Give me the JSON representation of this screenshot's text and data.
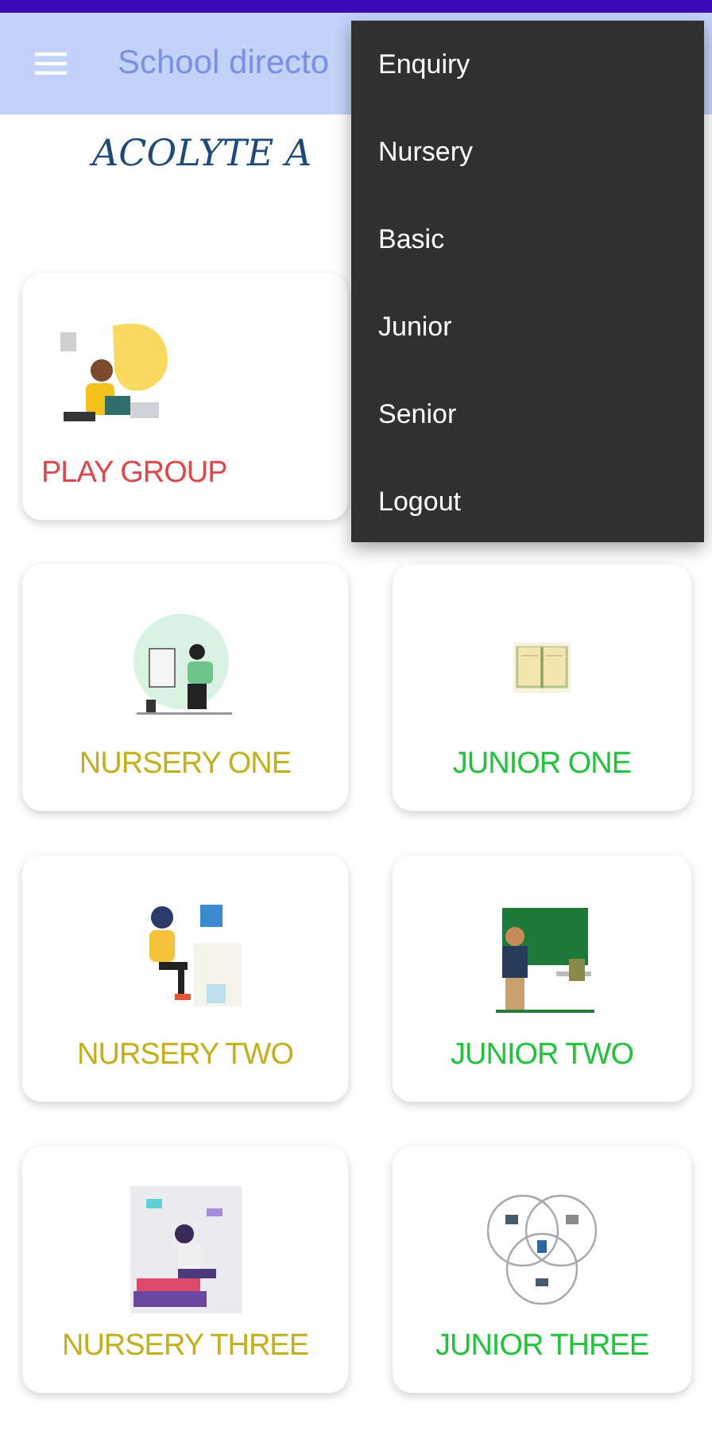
{
  "app_bar": {
    "title": "School directo"
  },
  "heading": "ACOLYTE A",
  "cards": [
    {
      "label": "PLAY GROUP",
      "color": "#e0474a"
    },
    {
      "label": "NURSERY ONE",
      "color": "#c4b01c"
    },
    {
      "label": "JUNIOR ONE",
      "color": "#1fc43a"
    },
    {
      "label": "NURSERY TWO",
      "color": "#c4b01c"
    },
    {
      "label": "JUNIOR TWO",
      "color": "#1fc43a"
    },
    {
      "label": "NURSERY THREE",
      "color": "#c4b01c"
    },
    {
      "label": "JUNIOR THREE",
      "color": "#1fc43a"
    }
  ],
  "menu": {
    "items": [
      "Enquiry",
      "Nursery",
      "Basic",
      "Junior",
      "Senior",
      "Logout"
    ]
  }
}
